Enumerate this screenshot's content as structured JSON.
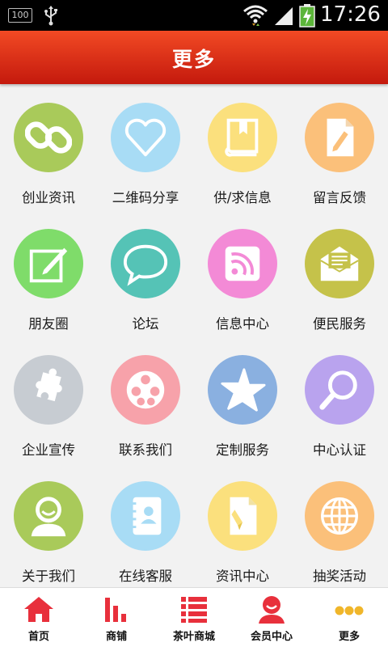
{
  "status_bar": {
    "battery_level": "100",
    "time": "17:26"
  },
  "header": {
    "title": "更多"
  },
  "grid_items": [
    {
      "label": "创业资讯",
      "color": "#a9ca5a",
      "icon": "link-icon"
    },
    {
      "label": "二维码分享",
      "color": "#a8dcf5",
      "icon": "heart-icon"
    },
    {
      "label": "供/求信息",
      "color": "#fbe07d",
      "icon": "book-icon"
    },
    {
      "label": "留言反馈",
      "color": "#fbc07a",
      "icon": "note-edit-icon"
    },
    {
      "label": "朋友圈",
      "color": "#7fdc6a",
      "icon": "edit-square-icon"
    },
    {
      "label": "论坛",
      "color": "#55c3b6",
      "icon": "chat-bubble-icon"
    },
    {
      "label": "信息中心",
      "color": "#f38ad6",
      "icon": "rss-icon"
    },
    {
      "label": "便民服务",
      "color": "#c5c24a",
      "icon": "envelope-icon"
    },
    {
      "label": "企业宣传",
      "color": "#c7ccd2",
      "icon": "puzzle-icon"
    },
    {
      "label": "联系我们",
      "color": "#f7a2aa",
      "icon": "film-reel-icon"
    },
    {
      "label": "定制服务",
      "color": "#8ab0e0",
      "icon": "star-icon"
    },
    {
      "label": "中心认证",
      "color": "#b9a3ee",
      "icon": "magnifier-icon"
    },
    {
      "label": "关于我们",
      "color": "#a9ca5a",
      "icon": "user-icon"
    },
    {
      "label": "在线客服",
      "color": "#a8dcf5",
      "icon": "contacts-book-icon"
    },
    {
      "label": "资讯中心",
      "color": "#fbe07d",
      "icon": "document-edit-icon"
    },
    {
      "label": "抽奖活动",
      "color": "#fbc07a",
      "icon": "globe-icon"
    }
  ],
  "tabbar": {
    "accent": "#e8303c",
    "tabs": [
      {
        "label": "首页",
        "icon": "home-icon"
      },
      {
        "label": "商铺",
        "icon": "bar-chart-icon"
      },
      {
        "label": "茶叶商城",
        "icon": "list-icon"
      },
      {
        "label": "会员中心",
        "icon": "member-icon"
      },
      {
        "label": "更多",
        "icon": "more-dots-icon"
      }
    ]
  }
}
